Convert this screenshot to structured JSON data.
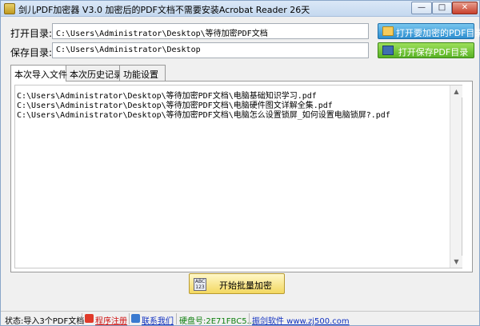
{
  "window": {
    "title": "剑儿PDF加密器  V3.0 加密后的PDF文档不需要安装Acrobat Reader  26天",
    "controls": {
      "minimize": "—",
      "maximize": "□",
      "close": "✕"
    }
  },
  "open_dir": {
    "label": "打开目录:",
    "value": "C:\\Users\\Administrator\\Desktop\\等待加密PDF文档",
    "button_label": "打开要加密的PDF目录",
    "button_icon": "folder-icon"
  },
  "save_dir": {
    "label": "保存目录:",
    "value": "C:\\Users\\Administrator\\Desktop",
    "button_label": "打开保存PDF目录",
    "button_icon": "disk-icon"
  },
  "tabs": [
    {
      "label": "本次导入文件",
      "active": true
    },
    {
      "label": "本次历史记录",
      "active": false
    },
    {
      "label": "功能设置",
      "active": false
    }
  ],
  "files": [
    "C:\\Users\\Administrator\\Desktop\\等待加密PDF文档\\电脑基础知识学习.pdf",
    "C:\\Users\\Administrator\\Desktop\\等待加密PDF文档\\电脑硬件图文详解全集.pdf",
    "C:\\Users\\Administrator\\Desktop\\等待加密PDF文档\\电脑怎么设置锁屏_如何设置电脑锁屏?.pdf"
  ],
  "scrollbar": {
    "up": "▲",
    "down": "▼"
  },
  "start_button": {
    "label": "开始批量加密",
    "icon_text": "ABC 123"
  },
  "status": {
    "state": "状态:导入3个PDF文档",
    "register": "程序注册",
    "contact": "联系我们",
    "hardware": "硬盘号:2E71FBC5...",
    "website": "振剑软件 www.zj500.com"
  },
  "colors": {
    "open_button": "#2f8fd0",
    "save_button": "#58b224",
    "start_button": "#f3d860",
    "register_link": "#d01010",
    "link_blue": "#1030c0"
  }
}
